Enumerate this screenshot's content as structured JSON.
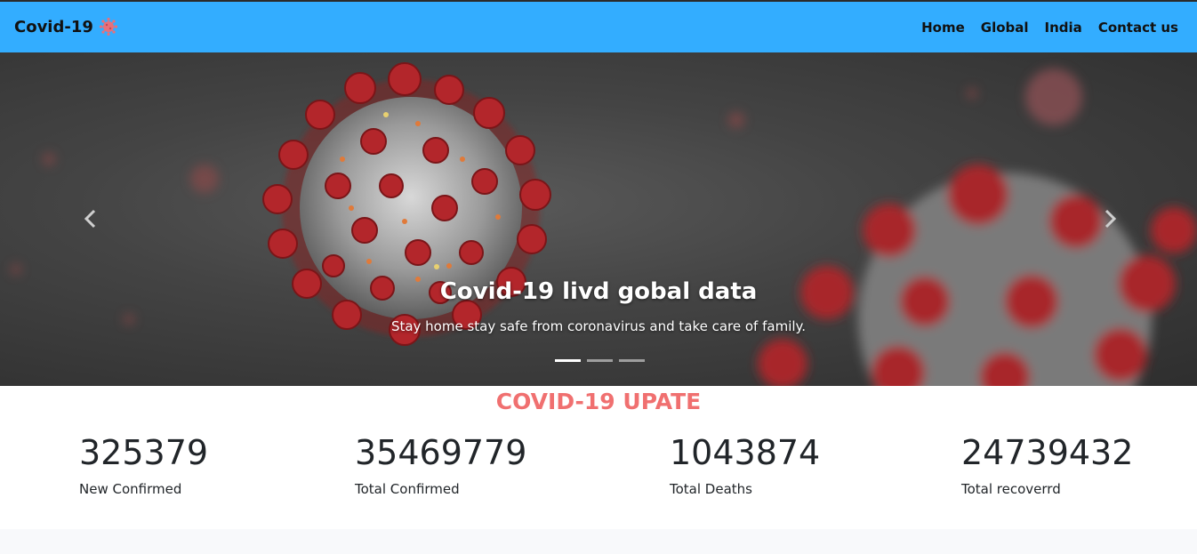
{
  "navbar": {
    "brand": "Covid-19",
    "brand_icon": "virus-icon",
    "background": "#33adff",
    "links": [
      {
        "label": "Home"
      },
      {
        "label": "Global"
      },
      {
        "label": "India"
      },
      {
        "label": "Contact us"
      }
    ]
  },
  "carousel": {
    "title": "Covid-19 livd gobal data",
    "subtitle": "Stay home stay safe from coronavirus and take care of family.",
    "prev_icon": "chevron-left-icon",
    "next_icon": "chevron-right-icon",
    "indicators": 3,
    "active_indicator": 0
  },
  "update": {
    "title": "COVID-19 UPATE",
    "color": "#f07070",
    "stats": [
      {
        "value": "325379",
        "label": "New Confirmed"
      },
      {
        "value": "35469779",
        "label": "Total Confirmed"
      },
      {
        "value": "1043874",
        "label": "Total Deaths"
      },
      {
        "value": "24739432",
        "label": "Total recoverrd"
      }
    ]
  }
}
